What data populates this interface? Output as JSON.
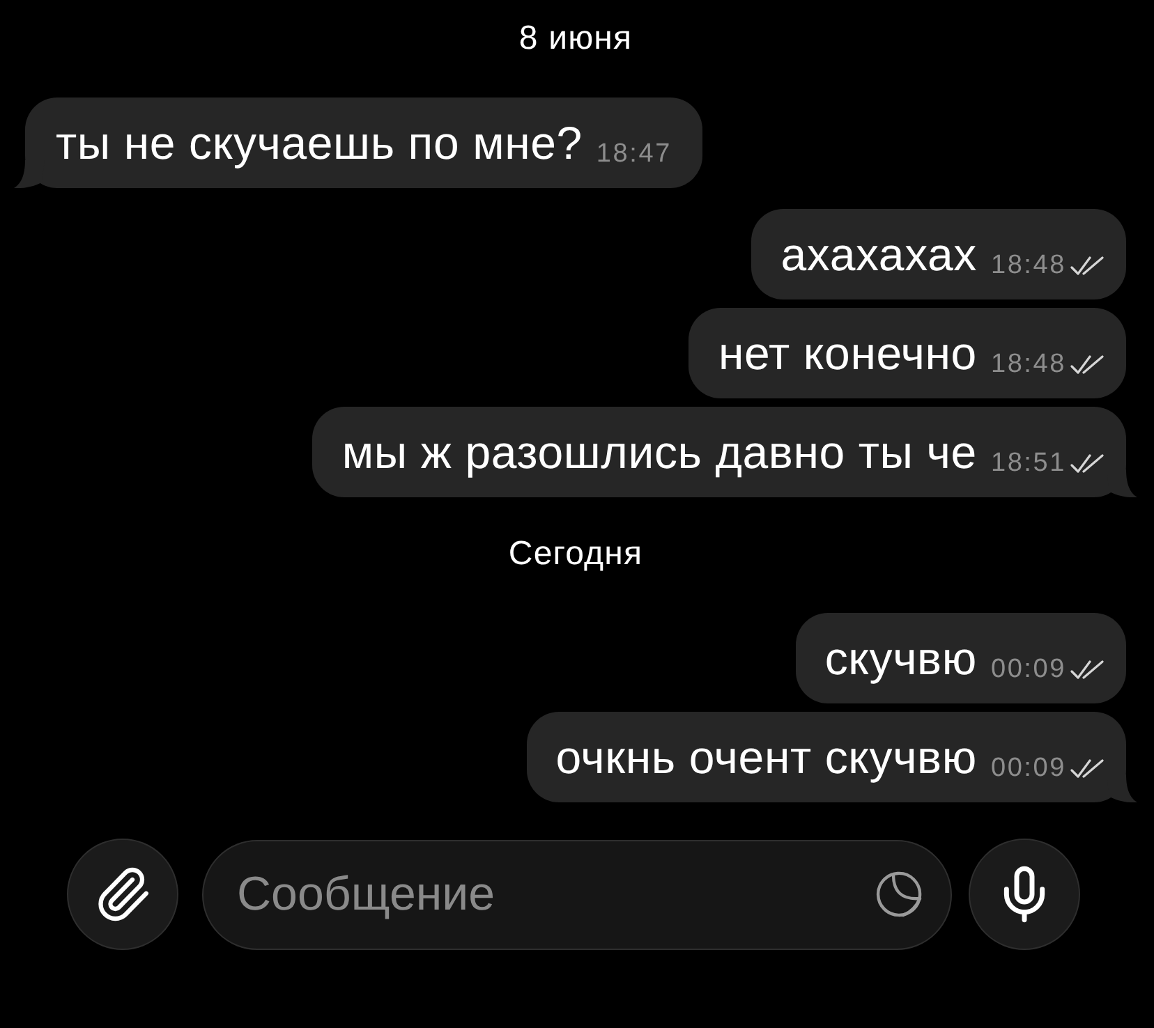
{
  "chat": [
    {
      "kind": "date",
      "text": "8 июня"
    },
    {
      "kind": "incoming",
      "text": "ты не скучаешь по мне?",
      "time": "18:47"
    },
    {
      "kind": "outgoing",
      "text": "ахахахах",
      "time": "18:48",
      "read": true
    },
    {
      "kind": "outgoing",
      "text": "нет конечно",
      "time": "18:48",
      "read": true
    },
    {
      "kind": "outgoing",
      "text": "мы ж разошлись давно ты че",
      "time": "18:51",
      "read": true
    },
    {
      "kind": "date",
      "text": "Сегодня"
    },
    {
      "kind": "outgoing",
      "text": "скучвю",
      "time": "00:09",
      "read": true
    },
    {
      "kind": "outgoing",
      "text": "очкнь очент скучвю",
      "time": "00:09",
      "read": true
    }
  ],
  "composer": {
    "placeholder": "Сообщение"
  }
}
